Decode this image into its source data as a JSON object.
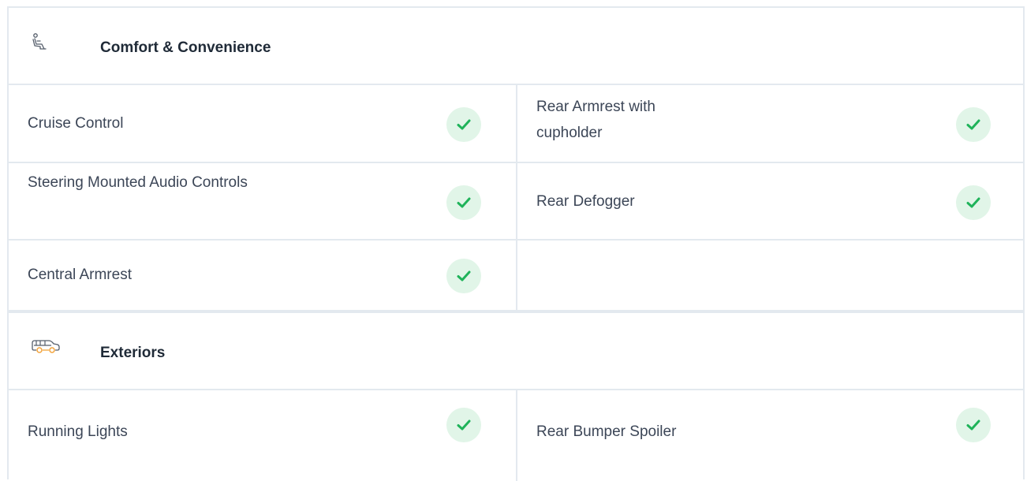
{
  "sections": [
    {
      "title": "Comfort & Convenience",
      "icon": "seat-icon",
      "features": [
        {
          "label": "Cruise Control",
          "available": true
        },
        {
          "label": "Rear Armrest with cupholder",
          "available": true
        },
        {
          "label": "Steering Mounted Audio Controls",
          "available": true
        },
        {
          "label": "Rear Defogger",
          "available": true
        },
        {
          "label": "Central Armrest",
          "available": true
        }
      ]
    },
    {
      "title": "Exteriors",
      "icon": "car-icon",
      "features": [
        {
          "label": "Running Lights",
          "available": true
        },
        {
          "label": "Rear Bumper Spoiler",
          "available": true
        }
      ]
    }
  ],
  "colors": {
    "border": "#e3e9ef",
    "check_bg": "#e1f5e8",
    "check_mark": "#1fb35a",
    "car_icon_accent": "#f2a33a",
    "heading_text": "#1f2a37",
    "body_text": "#3c4657"
  }
}
